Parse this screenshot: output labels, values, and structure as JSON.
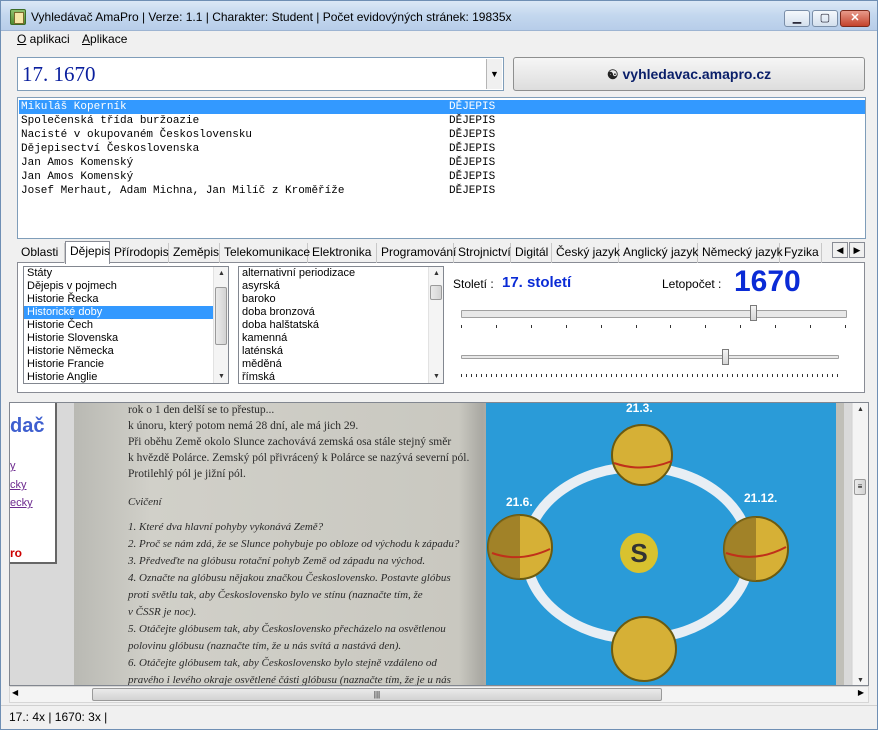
{
  "window": {
    "title": "Vyhledávač AmaPro | Verze: 1.1 | Charakter: Student | Počet evidovýných stránek: 19835x",
    "minimize_glyph": "▁",
    "maximize_glyph": "▢",
    "close_glyph": "✕"
  },
  "menu": {
    "items": [
      {
        "underline": "O",
        "rest": " aplikaci"
      },
      {
        "underline": "A",
        "rest": "plikace"
      }
    ]
  },
  "search": {
    "value": "17. 1670",
    "dropdown_glyph": "▼",
    "link_button_label": "vyhledavac.amapro.cz",
    "link_icon": "binoculars-icon"
  },
  "results": [
    {
      "title": "Mikuláš Koperník",
      "category": "DĚJEPIS",
      "selected": true
    },
    {
      "title": "Společenská třída buržoazie",
      "category": "DĚJEPIS"
    },
    {
      "title": "Nacisté v okupovaném Československu",
      "category": "DĚJEPIS"
    },
    {
      "title": "Dějepisectví Československa",
      "category": "DĚJEPIS"
    },
    {
      "title": "Jan Amos Komenský",
      "category": "DĚJEPIS"
    },
    {
      "title": "Jan Amos Komenský",
      "category": "DĚJEPIS"
    },
    {
      "title": "Josef Merhaut, Adam Michna, Jan Milíč z Kroměříže",
      "category": "DĚJEPIS"
    }
  ],
  "tabs": [
    "Oblasti",
    "Dějepis",
    "Přírodopis",
    "Zeměpis",
    "Telekomunikace",
    "Elektronika",
    "Programování",
    "Strojnictví",
    "Digitál",
    "Český jazyk",
    "Anglický jazyk",
    "Německý jazyk",
    "Fyzika"
  ],
  "active_tab": "Dějepis",
  "tab_scroll": {
    "left": "◀",
    "right": "▶"
  },
  "topics": [
    "Státy",
    "Dějepis v pojmech",
    "Historie Řecka",
    "Historické doby",
    "Historie Čech",
    "Historie Slovenska",
    "Historie Německa",
    "Historie Francie",
    "Historie Anglie"
  ],
  "selected_topic": "Historické doby",
  "periods": [
    "alternativní periodizace",
    "asyrská",
    "baroko",
    "doba bronzová",
    "doba halštatská",
    "kamenná",
    "laténská",
    "měděná",
    "římská"
  ],
  "timeline": {
    "century_label": "Století :",
    "century_value": "17. století",
    "year_label": "Letopočet :",
    "year_value": "1670",
    "century_slider_fraction": 0.76,
    "year_slider_fraction": 0.7
  },
  "web_pane": {
    "title": "dač",
    "links": [
      "y",
      "cky",
      "ecky"
    ],
    "red_text": "ro"
  },
  "book": {
    "lines": [
      "rok o 1 den delší se to přestup...",
      "k únoru, který potom nemá 28 dní, ale má jich 29.",
      "Při oběhu Země okolo Slunce zachovává zemská osa stále stejný směr",
      "k hvězdě Polárce. Zemský pól přivrácený k Polárce se nazývá severní pól.",
      "Protilehlý pól je jižní pól."
    ],
    "exercise_title": "Cvičení",
    "questions": [
      "1. Které dva hlavní pohyby vykonává Země?",
      "2. Proč se nám zdá, že se Slunce pohybuje po obloze od východu k západu?",
      "3. Předveďte na glóbusu rotační pohyb Země od západu na východ.",
      "4. Označte na glóbusu nějakou značkou Československo. Postavte glóbus",
      "proti světlu tak, aby Československo bylo ve stínu (naznačte tím, že",
      "v ČSSR je noc).",
      "5. Otáčejte glóbusem tak, aby Československo přecházelo na osvětlenou",
      "polovinu glóbusu (naznačte tím, že u nás svítá a nastává den).",
      "6. Otáčejte glóbusem tak, aby Československo bylo stejně vzdáleno od",
      "pravého i levého okraje osvětlené části glóbusu (naznačte tím, že je u nás"
    ],
    "figure_labels": [
      "21.3.",
      "21.6.",
      "21.12."
    ],
    "sun_letter": "S"
  },
  "scroll_glyphs": {
    "up": "▲",
    "down": "▼",
    "left": "◀",
    "right": "▶",
    "grip": "≡",
    "hgrip": "|||"
  },
  "status": "17.: 4x | 1670: 3x |"
}
